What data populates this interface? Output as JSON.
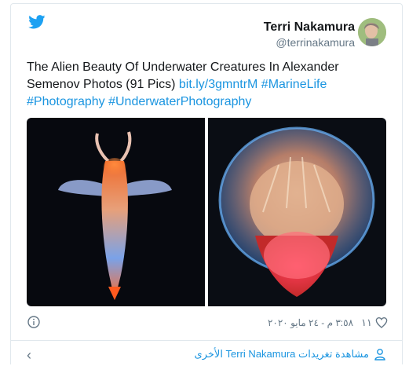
{
  "tweet": {
    "author_name": "Terri Nakamura",
    "author_handle": "@terrinakamura",
    "text_plain": "The Alien Beauty Of Underwater Creatures In Alexander Semenov Photos (91 Pics) ",
    "link": "bit.ly/3gmntrM",
    "hashtags": [
      "#MarineLife",
      "#Photography",
      "#UnderwaterPhotography"
    ],
    "likes": "١١",
    "timestamp": "٣:٥٨ م - ٢٤ مايو ٢٠٢٠"
  },
  "footer": {
    "more_tweets": "مشاهدة تغريدات Terri Nakamura الأخرى"
  },
  "icons": {
    "brand": "twitter-bird-icon",
    "info": "info-icon",
    "like": "heart-icon",
    "profile": "person-icon",
    "back": "chevron-left-icon"
  },
  "colors": {
    "accent": "#1b95e0",
    "brand": "#1da1f2",
    "muted": "#657786"
  }
}
